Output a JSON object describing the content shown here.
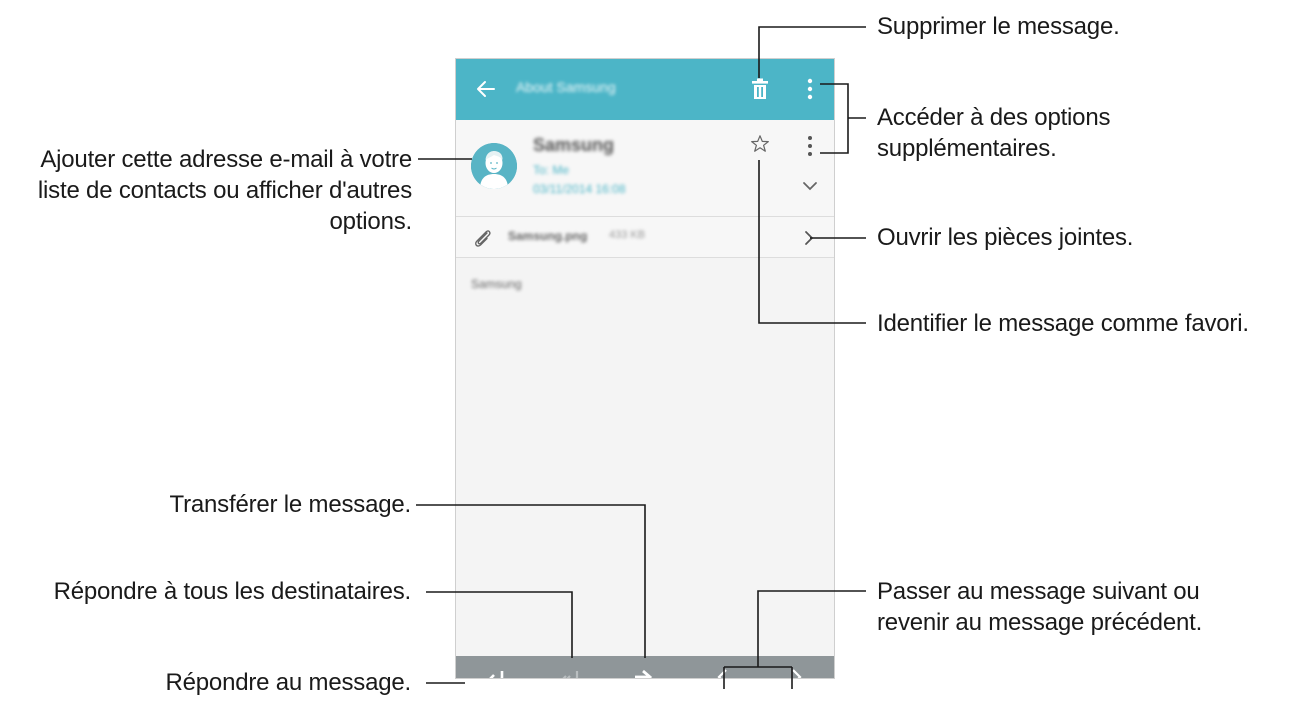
{
  "screen": {
    "header": {
      "title": "About Samsung",
      "back_icon": "back-arrow-icon",
      "delete_icon": "trash-icon",
      "more_icon": "more-vertical-icon",
      "color": "#4cb5c7"
    },
    "sender": {
      "name": "Samsung",
      "to": "To: Me",
      "date": "03/11/2014 16:08"
    },
    "attachment": {
      "name": "Samsung.png",
      "size": "433 KB"
    },
    "body": "Samsung",
    "bottom_bar": {
      "color": "#8f9699",
      "buttons": [
        "reply-icon",
        "reply-all-icon",
        "forward-icon",
        "previous-icon",
        "next-icon"
      ]
    }
  },
  "callouts": {
    "delete": "Supprimer le message.",
    "options_line1": "Accéder à des options",
    "options_line2": "supplémentaires.",
    "contact_line1": "Ajouter cette adresse e-mail à votre",
    "contact_line2": "liste de contacts ou afficher d'autres",
    "contact_line3": "options.",
    "attachments": "Ouvrir les pièces jointes.",
    "favorite": "Identifier le message comme favori.",
    "forward": "Transférer le message.",
    "reply_all": "Répondre à tous les destinataires.",
    "reply": "Répondre au message.",
    "navigate_line1": "Passer au message suivant ou",
    "navigate_line2": "revenir au message précédent."
  }
}
